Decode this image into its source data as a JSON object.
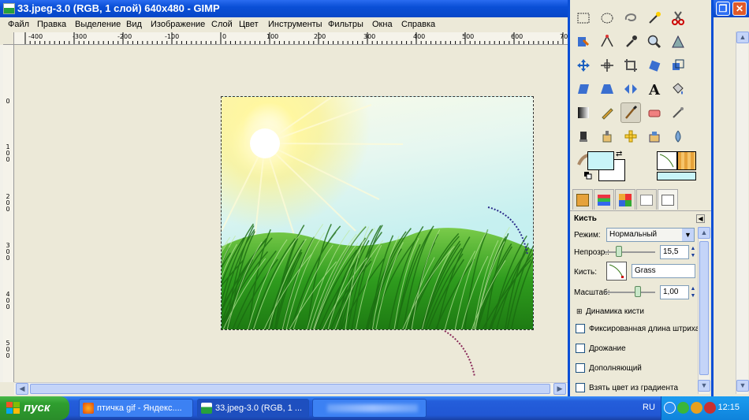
{
  "window": {
    "title": "33.jpeg-3.0 (RGB, 1 слой) 640x480 - GIMP"
  },
  "menu": [
    "Файл",
    "Правка",
    "Выделение",
    "Вид",
    "Изображение",
    "Слой",
    "Цвет",
    "Инструменты",
    "Фильтры",
    "Окна",
    "Справка"
  ],
  "ruler": {
    "top_labels": [
      "-400",
      "-300",
      "-200",
      "-100",
      "0",
      "100",
      "200",
      "300",
      "400",
      "500",
      "600",
      "700"
    ],
    "left_labels": [
      "0",
      "100",
      "200",
      "300",
      "400",
      "500"
    ]
  },
  "tool_options": {
    "title": "Кисть",
    "mode_label": "Режим:",
    "mode_value": "Нормальный",
    "opacity_label": "Непрозр.:",
    "opacity_value": "15,5",
    "brush_label": "Кисть:",
    "brush_value": "Grass",
    "scale_label": "Масштаб:",
    "scale_value": "1,00",
    "dynamics_label": "Динамика кисти",
    "options": [
      "Фиксированная длина штриха",
      "Дрожание",
      "Дополняющий",
      "Взять цвет из градиента"
    ]
  },
  "colors": {
    "foreground": "#c8f4f8",
    "background": "#ffffff"
  },
  "taskbar": {
    "start_label": "пуск",
    "tasks": [
      {
        "label": "птичка gif - Яндекс....",
        "active": false
      },
      {
        "label": "33.jpeg-3.0 (RGB, 1 ...",
        "active": true
      },
      {
        "label": "",
        "active": false
      }
    ],
    "language": "RU",
    "clock": "12:15"
  }
}
